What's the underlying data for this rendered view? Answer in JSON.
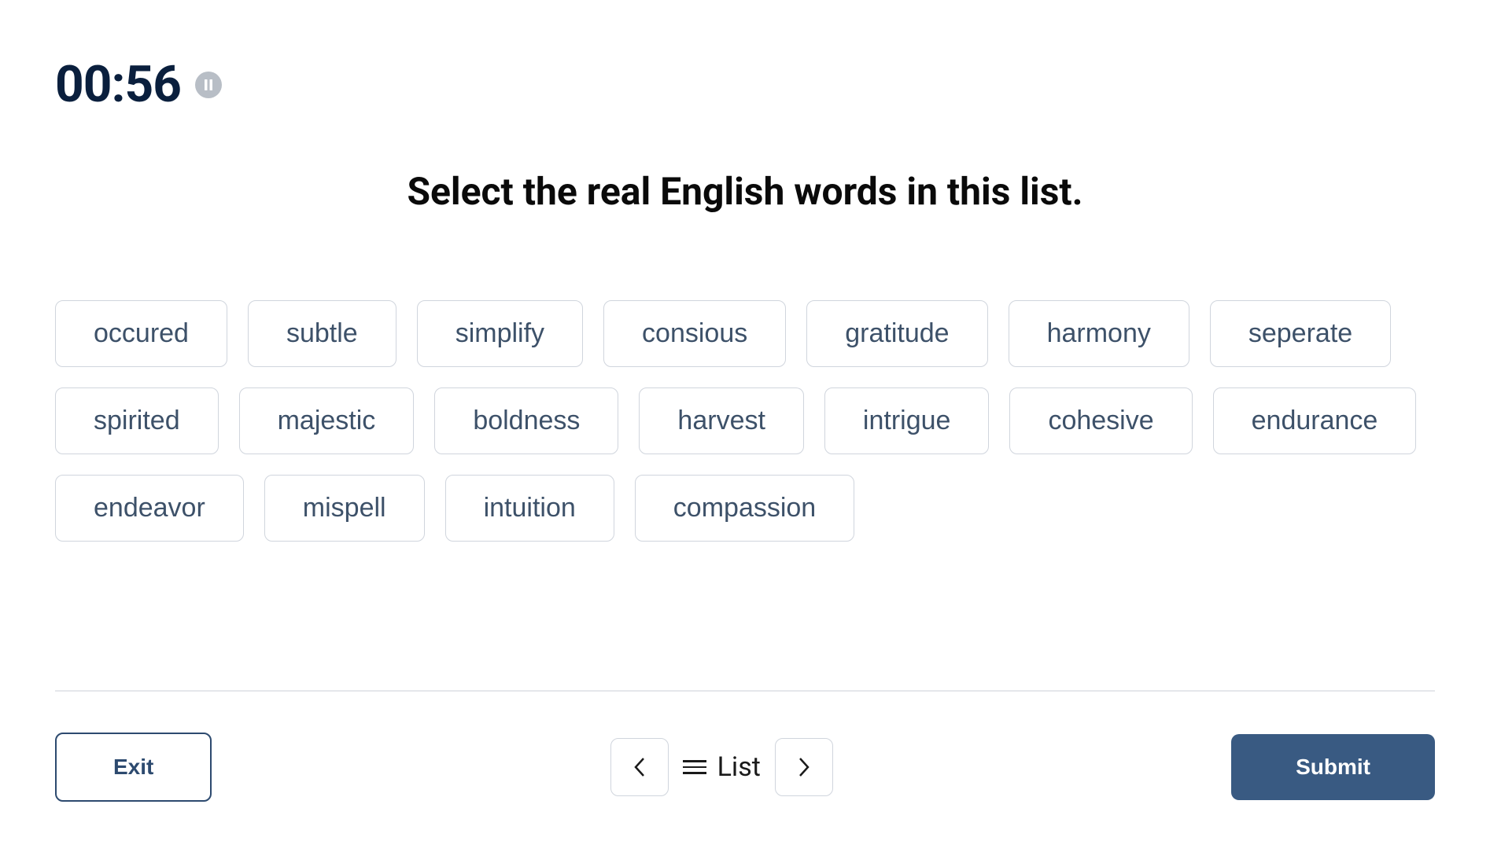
{
  "timer": "00:56",
  "instruction": "Select the real English words in this list.",
  "words": [
    "occured",
    "subtle",
    "simplify",
    "consious",
    "gratitude",
    "harmony",
    "seperate",
    "spirited",
    "majestic",
    "boldness",
    "harvest",
    "intrigue",
    "cohesive",
    "endurance",
    "endeavor",
    "mispell",
    "intuition",
    "compassion"
  ],
  "footer": {
    "exit_label": "Exit",
    "list_label": "List",
    "submit_label": "Submit"
  }
}
